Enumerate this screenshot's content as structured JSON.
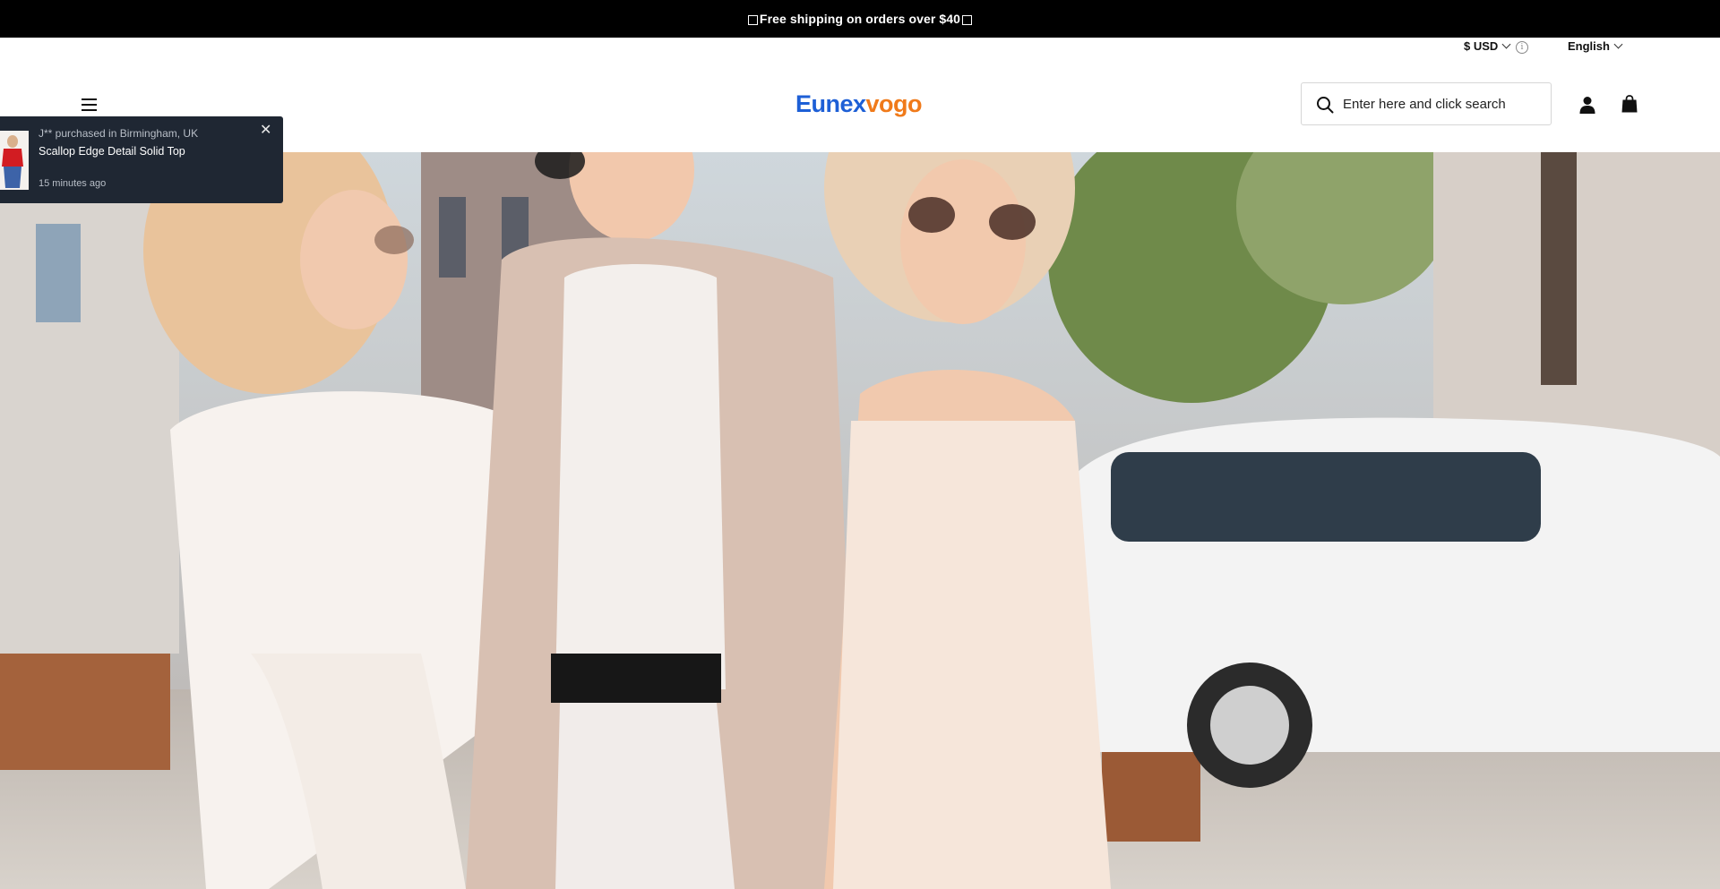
{
  "announcement": {
    "text": "Free shipping on orders over $40"
  },
  "utility": {
    "currency": "$ USD",
    "info_glyph": "i",
    "language": "English"
  },
  "header": {
    "logo_part1": "Eunex",
    "logo_part2": "vogo",
    "search_placeholder": "Enter here and click search",
    "icons": [
      "menu-icon",
      "search-icon",
      "account-icon",
      "shopping-bag-icon"
    ]
  },
  "popup": {
    "who": "J** purchased in Birmingham, UK",
    "product": "Scallop Edge Detail Solid Top",
    "time": "15 minutes ago",
    "close_glyph": "✕"
  },
  "colors": {
    "announcement_bg": "#000000",
    "logo_blue": "#1d5fd6",
    "logo_orange": "#f07a1a",
    "popup_bg": "#1f2733"
  }
}
